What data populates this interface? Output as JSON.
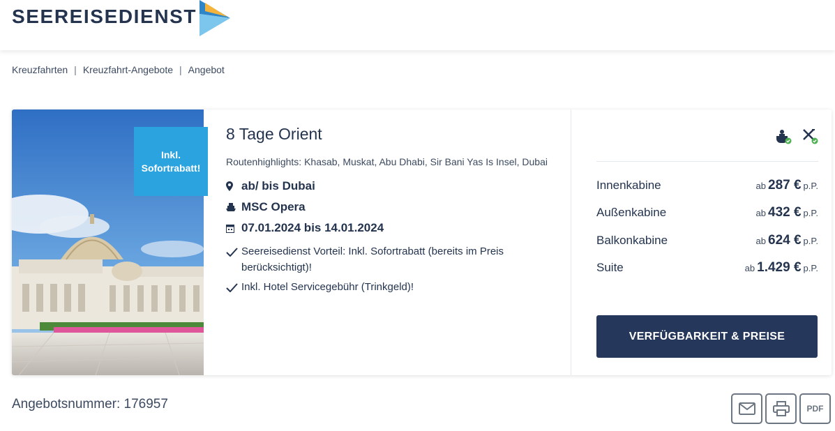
{
  "brand": {
    "name": "SEEREISEDIENST"
  },
  "breadcrumb": [
    {
      "label": "Kreuzfahrten"
    },
    {
      "label": "Kreuzfahrt-Angebote"
    },
    {
      "label": "Angebot"
    }
  ],
  "offer": {
    "badge": "Inkl. Sofortrabatt!",
    "title": "8 Tage Orient",
    "route_highlights": "Routenhighlights: Khasab, Muskat, Abu Dhabi, Sir Bani Yas Is Insel, Dubai",
    "port": "ab/ bis Dubai",
    "ship": "MSC Opera",
    "dates": "07.01.2024 bis 14.01.2024",
    "benefits": [
      "Seereisedienst Vorteil: Inkl. Sofortrabatt (bereits im Preis berücksichtigt)!",
      "Inkl. Hotel Servicegebühr (Trinkgeld)!"
    ],
    "amenity_icons": [
      "drinks-included-icon",
      "meals-included-icon"
    ],
    "prices": [
      {
        "cabin": "Innenkabine",
        "prefix": "ab",
        "amount": "287 €",
        "suffix": "p.P."
      },
      {
        "cabin": "Außenkabine",
        "prefix": "ab",
        "amount": "432 €",
        "suffix": "p.P."
      },
      {
        "cabin": "Balkonkabine",
        "prefix": "ab",
        "amount": "624 €",
        "suffix": "p.P."
      },
      {
        "cabin": "Suite",
        "prefix": "ab",
        "amount": "1.429 €",
        "suffix": "p.P."
      }
    ],
    "cta_label": "VERFÜGBARKEIT & PREISE"
  },
  "footer": {
    "offer_number": "Angebotsnummer: 176957",
    "pdf_label": "PDF"
  },
  "colors": {
    "navy": "#25375a",
    "badge_blue": "#2ba3df",
    "check_green": "#4caf50"
  }
}
